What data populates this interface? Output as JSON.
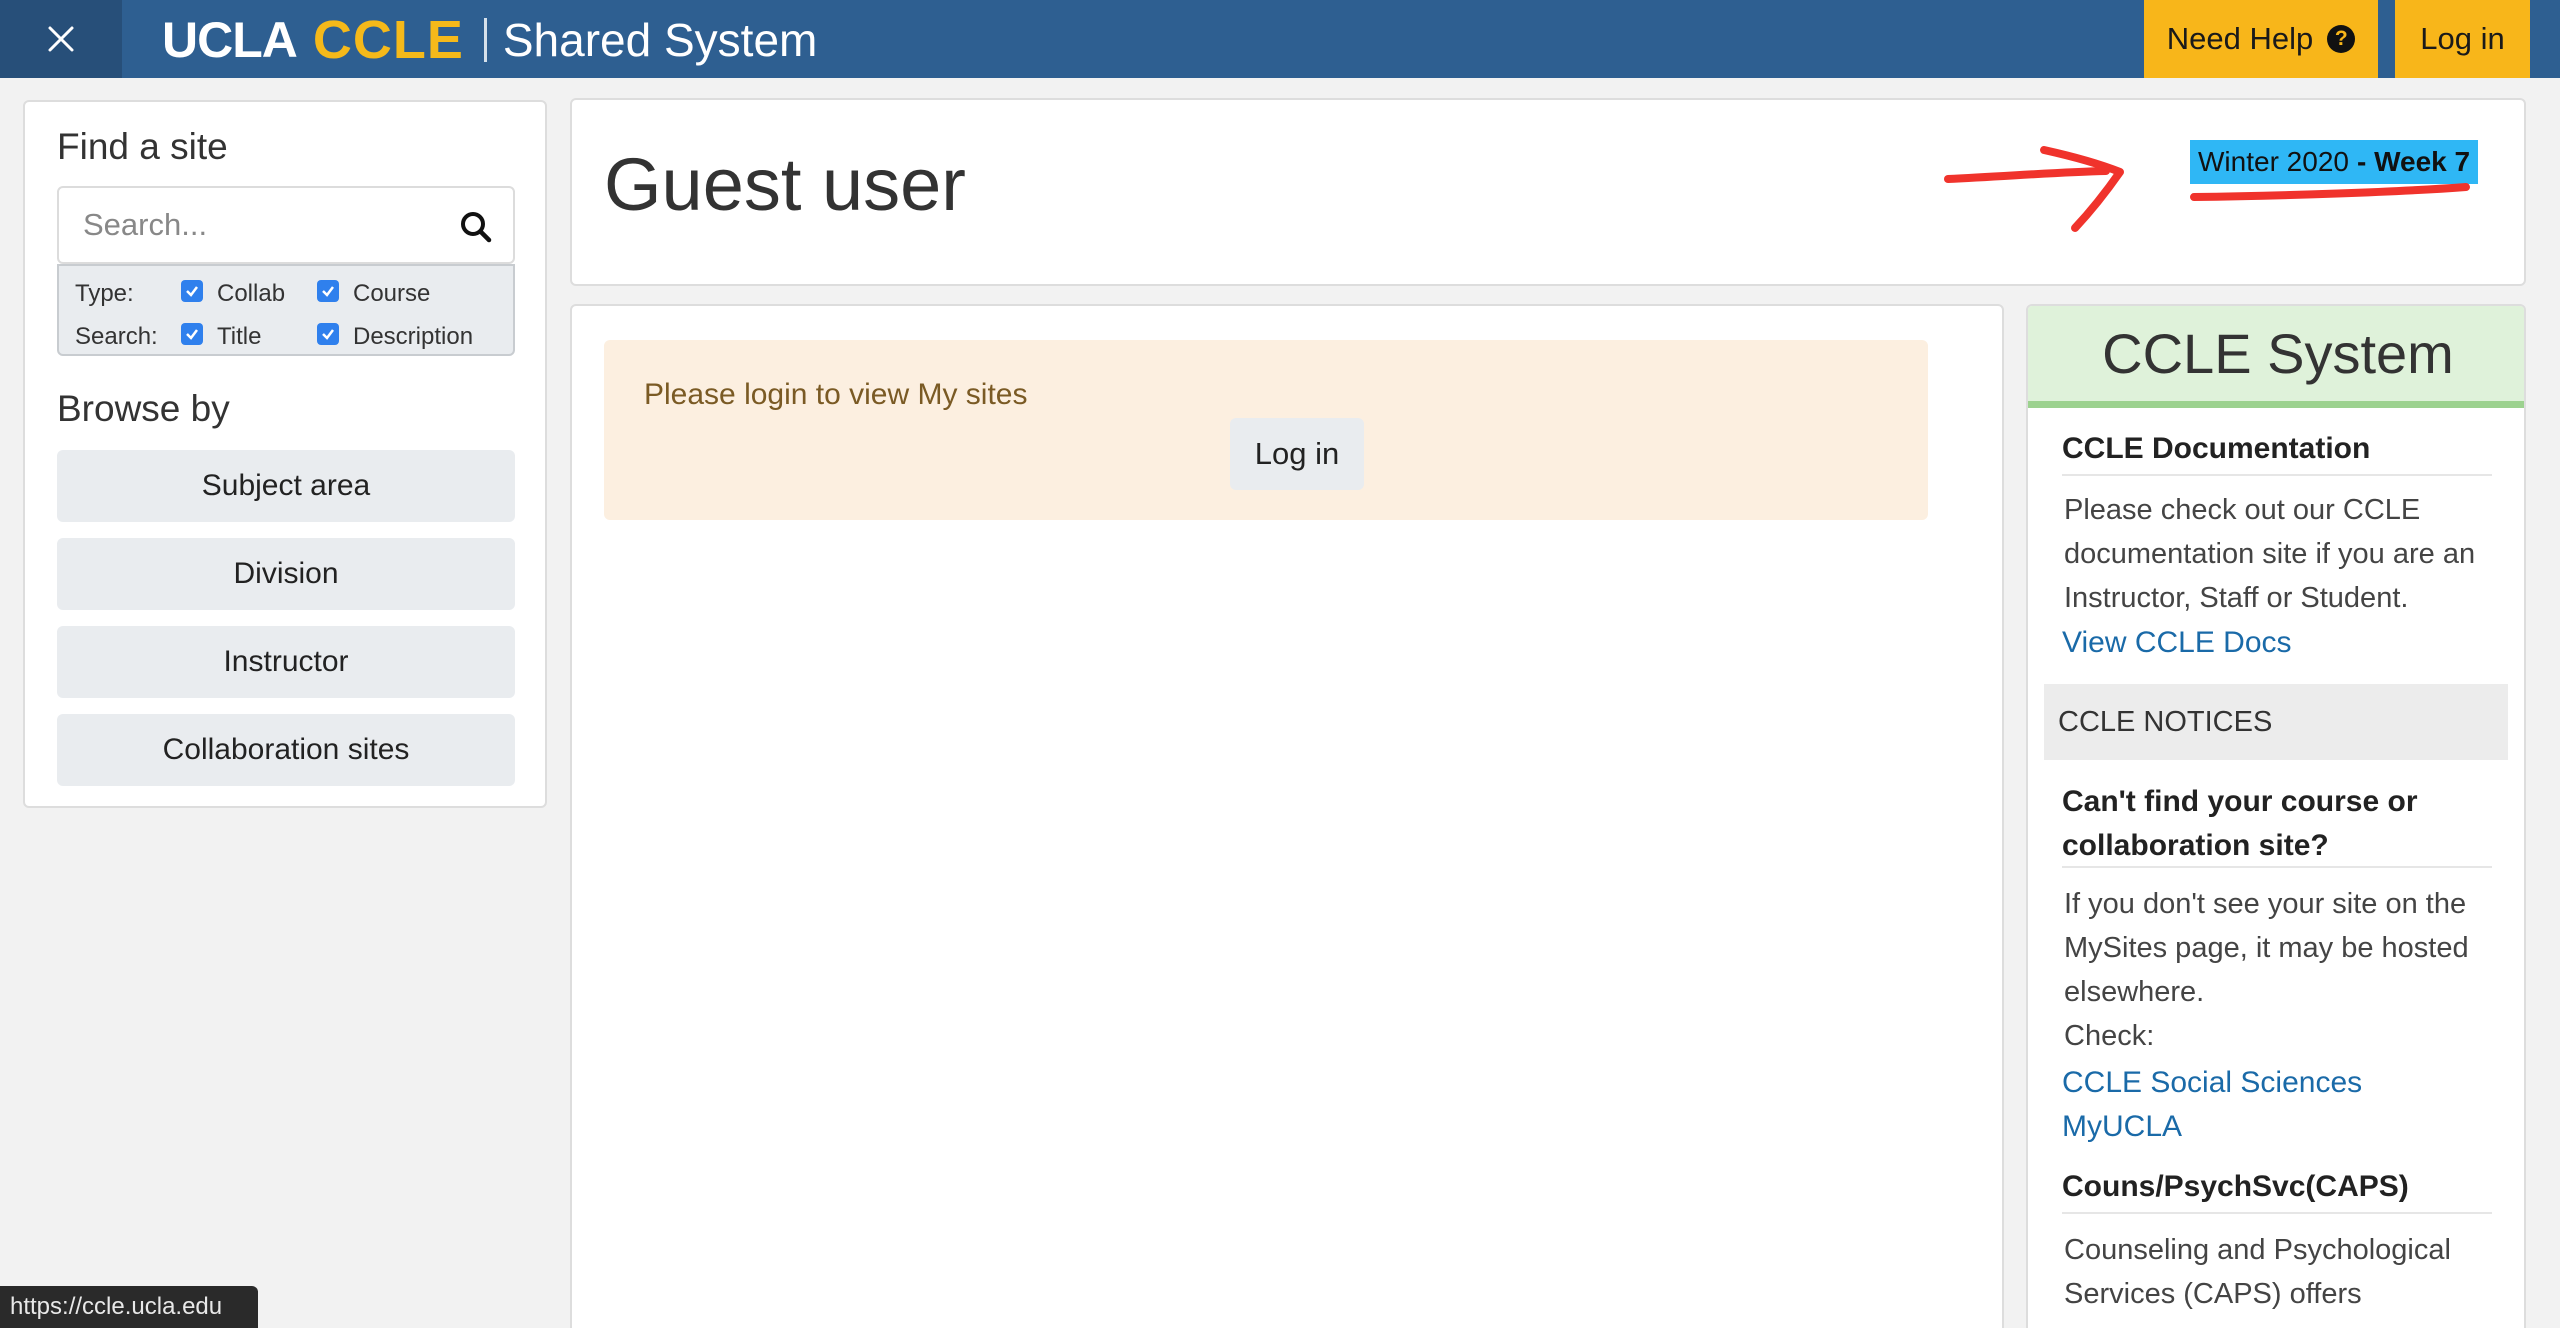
{
  "navbar": {
    "brand_ucla": "UCLA",
    "brand_ccle": "CCLE",
    "brand_subtitle": "Shared System",
    "need_help_label": "Need Help",
    "help_icon_glyph": "?",
    "login_label": "Log in",
    "colors": {
      "bar": "#2e5f91",
      "accent": "#f8b61a",
      "brand_gold": "#f5b91a"
    }
  },
  "sidebar": {
    "find_title": "Find a site",
    "search_placeholder": "Search...",
    "type_label": "Type:",
    "search_label": "Search:",
    "filters": {
      "collab": {
        "label": "Collab",
        "checked": true
      },
      "course": {
        "label": "Course",
        "checked": true
      },
      "title": {
        "label": "Title",
        "checked": true
      },
      "description": {
        "label": "Description",
        "checked": true
      }
    },
    "browse_title": "Browse by",
    "browse_items": [
      "Subject area",
      "Division",
      "Instructor",
      "Collaboration sites"
    ]
  },
  "header": {
    "title": "Guest user",
    "term": "Winter 2020",
    "week": "- Week 7",
    "highlight_color": "#2fb7f5",
    "annotation_color": "#f0332c"
  },
  "main": {
    "alert_text": "Please login to view My sites",
    "alert_login_label": "Log in"
  },
  "right": {
    "title": "CCLE System",
    "doc_heading": "CCLE Documentation",
    "doc_text": "Please check out our CCLE documentation site if you are an Instructor, Staff or Student.",
    "doc_link": "View CCLE Docs",
    "notices_label": "CCLE NOTICES",
    "notice1_heading": "Can't find your course or collaboration site?",
    "notice1_text": "If you don't see your site on the MySites page, it may be hosted elsewhere.",
    "notice1_check": "Check:",
    "notice1_links": [
      "CCLE Social Sciences",
      "MyUCLA"
    ],
    "notice2_heading": "Couns/PsychSvc(CAPS)",
    "notice2_text": "Counseling and Psychological Services (CAPS) offers"
  },
  "statusbar": {
    "url": "https://ccle.ucla.edu"
  }
}
